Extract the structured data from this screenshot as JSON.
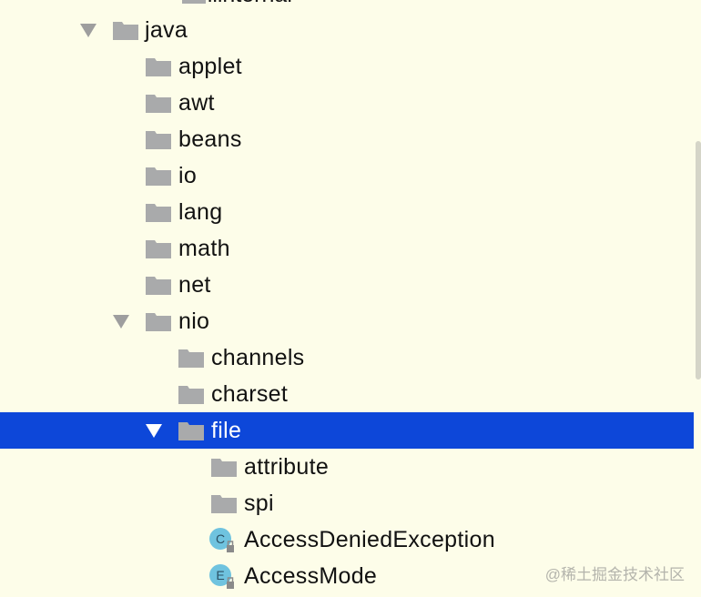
{
  "tree": {
    "top_fragment": "xmlinternal",
    "rows": [
      {
        "label": "java",
        "level": 0,
        "state": "expanded",
        "kind": "folder"
      },
      {
        "label": "applet",
        "level": 1,
        "state": "collapsed",
        "kind": "folder"
      },
      {
        "label": "awt",
        "level": 1,
        "state": "collapsed",
        "kind": "folder"
      },
      {
        "label": "beans",
        "level": 1,
        "state": "collapsed",
        "kind": "folder"
      },
      {
        "label": "io",
        "level": 1,
        "state": "collapsed",
        "kind": "folder"
      },
      {
        "label": "lang",
        "level": 1,
        "state": "collapsed",
        "kind": "folder"
      },
      {
        "label": "math",
        "level": 1,
        "state": "collapsed",
        "kind": "folder"
      },
      {
        "label": "net",
        "level": 1,
        "state": "collapsed",
        "kind": "folder"
      },
      {
        "label": "nio",
        "level": 1,
        "state": "expanded",
        "kind": "folder"
      },
      {
        "label": "channels",
        "level": 2,
        "state": "collapsed",
        "kind": "folder"
      },
      {
        "label": "charset",
        "level": 2,
        "state": "collapsed",
        "kind": "folder"
      },
      {
        "label": "file",
        "level": 2,
        "state": "expanded",
        "kind": "folder",
        "selected": true
      },
      {
        "label": "attribute",
        "level": 3,
        "state": "collapsed",
        "kind": "folder"
      },
      {
        "label": "spi",
        "level": 3,
        "state": "collapsed",
        "kind": "folder"
      },
      {
        "label": "AccessDeniedException",
        "level": 3,
        "state": "leaf",
        "kind": "class",
        "badge": "C"
      },
      {
        "label": "AccessMode",
        "level": 3,
        "state": "leaf",
        "kind": "enum",
        "badge": "E"
      }
    ]
  },
  "colors": {
    "background": "#fdfde9",
    "selection": "#0d47d9",
    "folder": "#a9aaab",
    "arrow": "#9e9e9e",
    "class_badge": "#6fc3df",
    "enum_badge": "#6fc3df"
  },
  "icons": {
    "folder": "folder-icon",
    "expanded": "triangle-down-icon",
    "collapsed": "triangle-right-icon",
    "class": "class-c-icon",
    "enum": "enum-e-icon"
  },
  "watermark": "@稀土掘金技术社区"
}
